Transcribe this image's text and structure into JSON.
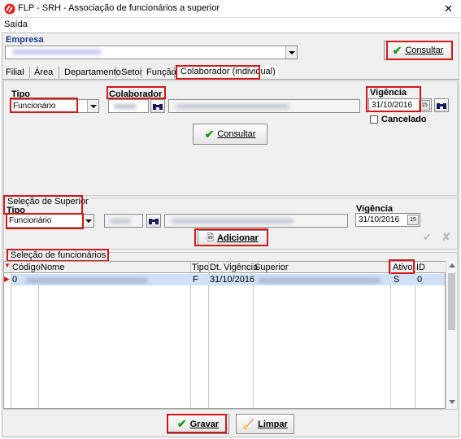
{
  "window": {
    "title": "FLP - SRH - Associação de funcionários a superior",
    "close": "✕"
  },
  "menu": {
    "saida": "Saída"
  },
  "empresa": {
    "label": "Empresa",
    "consultar": "Consultar"
  },
  "tabs": [
    {
      "label": "Filial"
    },
    {
      "label": "Área"
    },
    {
      "label": "Departamento"
    },
    {
      "label": "Setor"
    },
    {
      "label": "Função"
    },
    {
      "label": "Colaborador (individual)"
    }
  ],
  "filtro": {
    "tipo_label": "Tipo",
    "tipo_value": "Funcionário",
    "colaborador_label": "Colaborador",
    "vigencia_label": "Vigência",
    "vigencia_value": "31/10/2016",
    "cancelado_label": "Cancelado",
    "consultar": "Consultar"
  },
  "superior": {
    "group_label": "Seleção de Superior",
    "tipo_label": "Tipo",
    "tipo_value": "Funcionário",
    "vigencia_label": "Vigência",
    "vigencia_value": "31/10/2016",
    "adicionar": "Adicionar"
  },
  "grid": {
    "group_label": "Seleção de funcionários",
    "columns": [
      "Código",
      "Nome",
      "Tipo",
      "Dt. Vigência",
      "Superior",
      "Ativo",
      "ID"
    ],
    "rows": [
      {
        "codigo": "0",
        "tipo": "F",
        "vigencia": "31/10/2016",
        "ativo": "S",
        "id": "0"
      }
    ]
  },
  "footer": {
    "gravar": "Gravar",
    "limpar": "Limpar"
  },
  "colors": {
    "accent": "#d01818",
    "check": "#1a9a1a",
    "selection": "#cfe0f7"
  }
}
